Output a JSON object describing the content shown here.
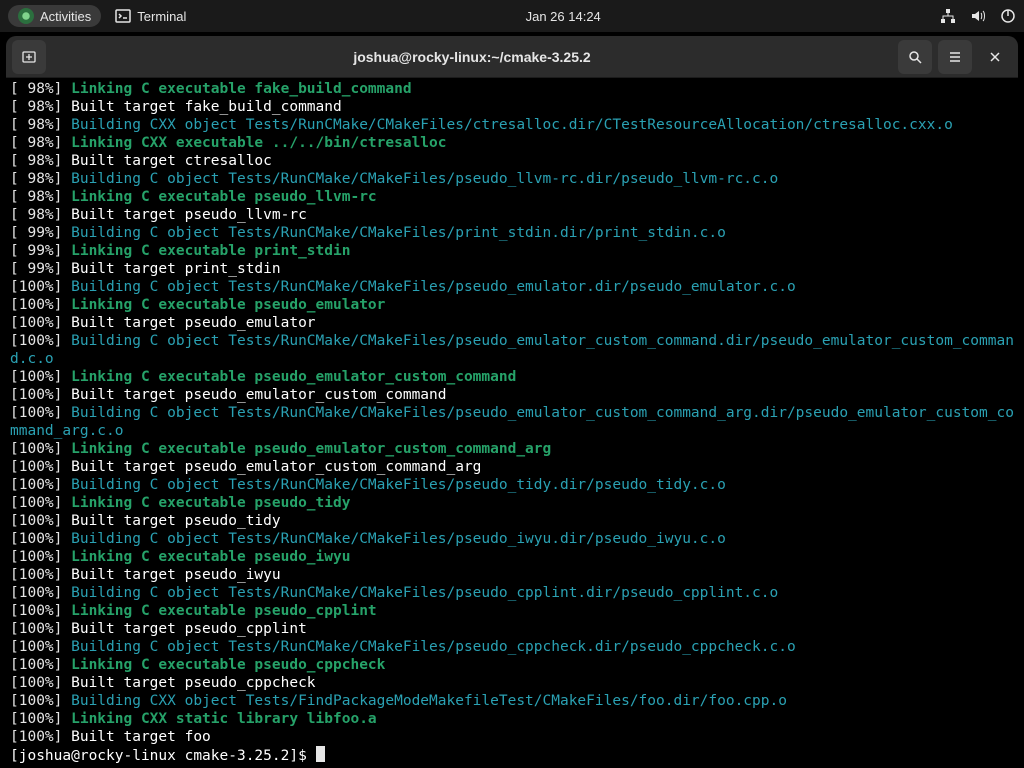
{
  "topbar": {
    "activities": "Activities",
    "app": "Terminal",
    "clock": "Jan 26  14:24"
  },
  "window": {
    "title": "joshua@rocky-linux:~/cmake-3.25.2"
  },
  "prompt": "[joshua@rocky-linux cmake-3.25.2]$ ",
  "lines": [
    {
      "p": "[ 98%] ",
      "c": "green",
      "t": "Linking C executable fake_build_command"
    },
    {
      "p": "[ 98%] ",
      "c": "plainw",
      "t": "Built target fake_build_command"
    },
    {
      "p": "[ 98%] ",
      "c": "cyan",
      "t": "Building CXX object Tests/RunCMake/CMakeFiles/ctresalloc.dir/CTestResourceAllocation/ctresalloc.cxx.o"
    },
    {
      "p": "[ 98%] ",
      "c": "green",
      "t": "Linking CXX executable ../../bin/ctresalloc"
    },
    {
      "p": "[ 98%] ",
      "c": "plainw",
      "t": "Built target ctresalloc"
    },
    {
      "p": "[ 98%] ",
      "c": "cyan",
      "t": "Building C object Tests/RunCMake/CMakeFiles/pseudo_llvm-rc.dir/pseudo_llvm-rc.c.o"
    },
    {
      "p": "[ 98%] ",
      "c": "green",
      "t": "Linking C executable pseudo_llvm-rc"
    },
    {
      "p": "[ 98%] ",
      "c": "plainw",
      "t": "Built target pseudo_llvm-rc"
    },
    {
      "p": "[ 99%] ",
      "c": "cyan",
      "t": "Building C object Tests/RunCMake/CMakeFiles/print_stdin.dir/print_stdin.c.o"
    },
    {
      "p": "[ 99%] ",
      "c": "green",
      "t": "Linking C executable print_stdin"
    },
    {
      "p": "[ 99%] ",
      "c": "plainw",
      "t": "Built target print_stdin"
    },
    {
      "p": "[100%] ",
      "c": "cyan",
      "t": "Building C object Tests/RunCMake/CMakeFiles/pseudo_emulator.dir/pseudo_emulator.c.o"
    },
    {
      "p": "[100%] ",
      "c": "green",
      "t": "Linking C executable pseudo_emulator"
    },
    {
      "p": "[100%] ",
      "c": "plainw",
      "t": "Built target pseudo_emulator"
    },
    {
      "p": "[100%] ",
      "c": "cyan",
      "t": "Building C object Tests/RunCMake/CMakeFiles/pseudo_emulator_custom_command.dir/pseudo_emulator_custom_command.c.o"
    },
    {
      "p": "[100%] ",
      "c": "green",
      "t": "Linking C executable pseudo_emulator_custom_command"
    },
    {
      "p": "[100%] ",
      "c": "plainw",
      "t": "Built target pseudo_emulator_custom_command"
    },
    {
      "p": "[100%] ",
      "c": "cyan",
      "t": "Building C object Tests/RunCMake/CMakeFiles/pseudo_emulator_custom_command_arg.dir/pseudo_emulator_custom_command_arg.c.o"
    },
    {
      "p": "[100%] ",
      "c": "green",
      "t": "Linking C executable pseudo_emulator_custom_command_arg"
    },
    {
      "p": "[100%] ",
      "c": "plainw",
      "t": "Built target pseudo_emulator_custom_command_arg"
    },
    {
      "p": "[100%] ",
      "c": "cyan",
      "t": "Building C object Tests/RunCMake/CMakeFiles/pseudo_tidy.dir/pseudo_tidy.c.o"
    },
    {
      "p": "[100%] ",
      "c": "green",
      "t": "Linking C executable pseudo_tidy"
    },
    {
      "p": "[100%] ",
      "c": "plainw",
      "t": "Built target pseudo_tidy"
    },
    {
      "p": "[100%] ",
      "c": "cyan",
      "t": "Building C object Tests/RunCMake/CMakeFiles/pseudo_iwyu.dir/pseudo_iwyu.c.o"
    },
    {
      "p": "[100%] ",
      "c": "green",
      "t": "Linking C executable pseudo_iwyu"
    },
    {
      "p": "[100%] ",
      "c": "plainw",
      "t": "Built target pseudo_iwyu"
    },
    {
      "p": "[100%] ",
      "c": "cyan",
      "t": "Building C object Tests/RunCMake/CMakeFiles/pseudo_cpplint.dir/pseudo_cpplint.c.o"
    },
    {
      "p": "[100%] ",
      "c": "green",
      "t": "Linking C executable pseudo_cpplint"
    },
    {
      "p": "[100%] ",
      "c": "plainw",
      "t": "Built target pseudo_cpplint"
    },
    {
      "p": "[100%] ",
      "c": "cyan",
      "t": "Building C object Tests/RunCMake/CMakeFiles/pseudo_cppcheck.dir/pseudo_cppcheck.c.o"
    },
    {
      "p": "[100%] ",
      "c": "green",
      "t": "Linking C executable pseudo_cppcheck"
    },
    {
      "p": "[100%] ",
      "c": "plainw",
      "t": "Built target pseudo_cppcheck"
    },
    {
      "p": "[100%] ",
      "c": "cyan",
      "t": "Building CXX object Tests/FindPackageModeMakefileTest/CMakeFiles/foo.dir/foo.cpp.o"
    },
    {
      "p": "[100%] ",
      "c": "green",
      "t": "Linking CXX static library libfoo.a"
    },
    {
      "p": "[100%] ",
      "c": "plainw",
      "t": "Built target foo"
    }
  ]
}
